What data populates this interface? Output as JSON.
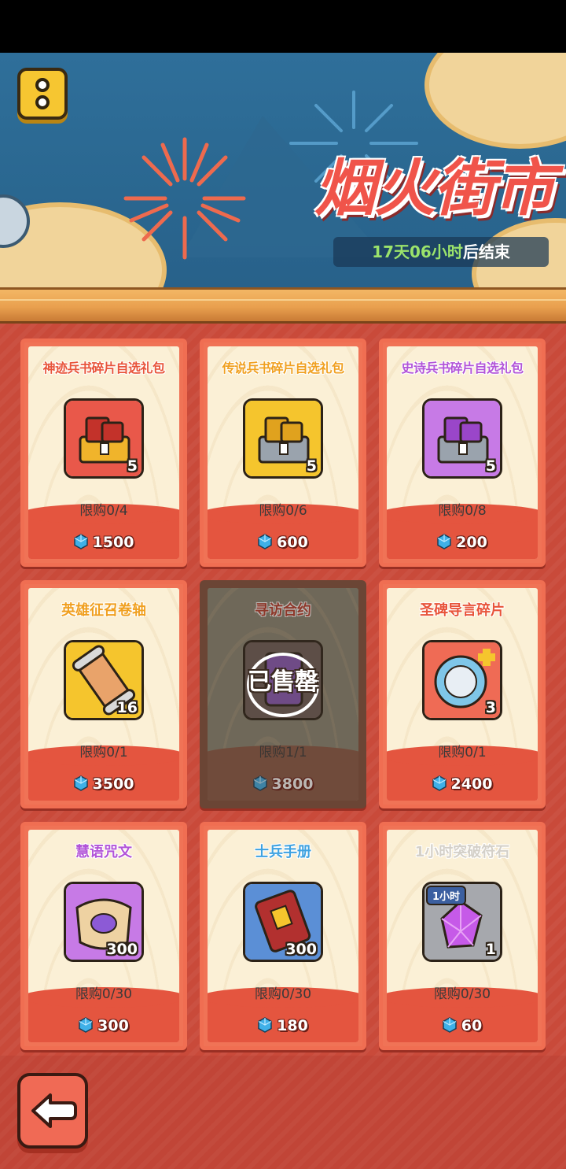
{
  "banner": {
    "title": "烟火街市",
    "timer_days": "17天06小时",
    "timer_suffix": "后结束"
  },
  "items": [
    {
      "name": "神迹兵书碎片自选礼包",
      "name_color": "#e8543a",
      "icon": "red-chest-icon",
      "qty": "5",
      "limit": "限购0/4",
      "price": "1500",
      "sold": false
    },
    {
      "name": "传说兵书碎片自选礼包",
      "name_color": "#f0a020",
      "icon": "gold-chest-icon",
      "qty": "5",
      "limit": "限购0/6",
      "price": "600",
      "sold": false
    },
    {
      "name": "史诗兵书碎片自选礼包",
      "name_color": "#b254d8",
      "icon": "purple-chest-icon",
      "qty": "5",
      "limit": "限购0/8",
      "price": "200",
      "sold": false
    },
    {
      "name": "英雄征召卷轴",
      "name_color": "#f0a020",
      "icon": "hero-scroll-icon",
      "qty": "16",
      "limit": "限购0/1",
      "price": "3500",
      "sold": false
    },
    {
      "name": "寻访合约",
      "name_color": "#b83c2c",
      "icon": "contract-icon",
      "qty": "",
      "limit": "限购1/1",
      "price": "3800",
      "sold": true,
      "sold_label": "已售罄"
    },
    {
      "name": "圣碑导言碎片",
      "name_color": "#e8543a",
      "icon": "stele-fragment-icon",
      "qty": "3",
      "limit": "限购0/1",
      "price": "2400",
      "sold": false
    },
    {
      "name": "慧语咒文",
      "name_color": "#b254d8",
      "icon": "spell-scroll-icon",
      "qty": "300",
      "limit": "限购0/30",
      "price": "300",
      "sold": false
    },
    {
      "name": "士兵手册",
      "name_color": "#3ea2e0",
      "icon": "soldier-book-icon",
      "qty": "300",
      "limit": "限购0/30",
      "price": "180",
      "sold": false
    },
    {
      "name": "1小时突破符石",
      "name_color": "#d4d0c8",
      "icon": "breakthrough-gem-icon",
      "qty": "1",
      "badge": "1小时",
      "limit": "限购0/30",
      "price": "60",
      "sold": false
    }
  ],
  "colors": {
    "card_border": "#f06e52",
    "card_bg": "#fbf0d6",
    "gem": "#3fb0e8"
  }
}
